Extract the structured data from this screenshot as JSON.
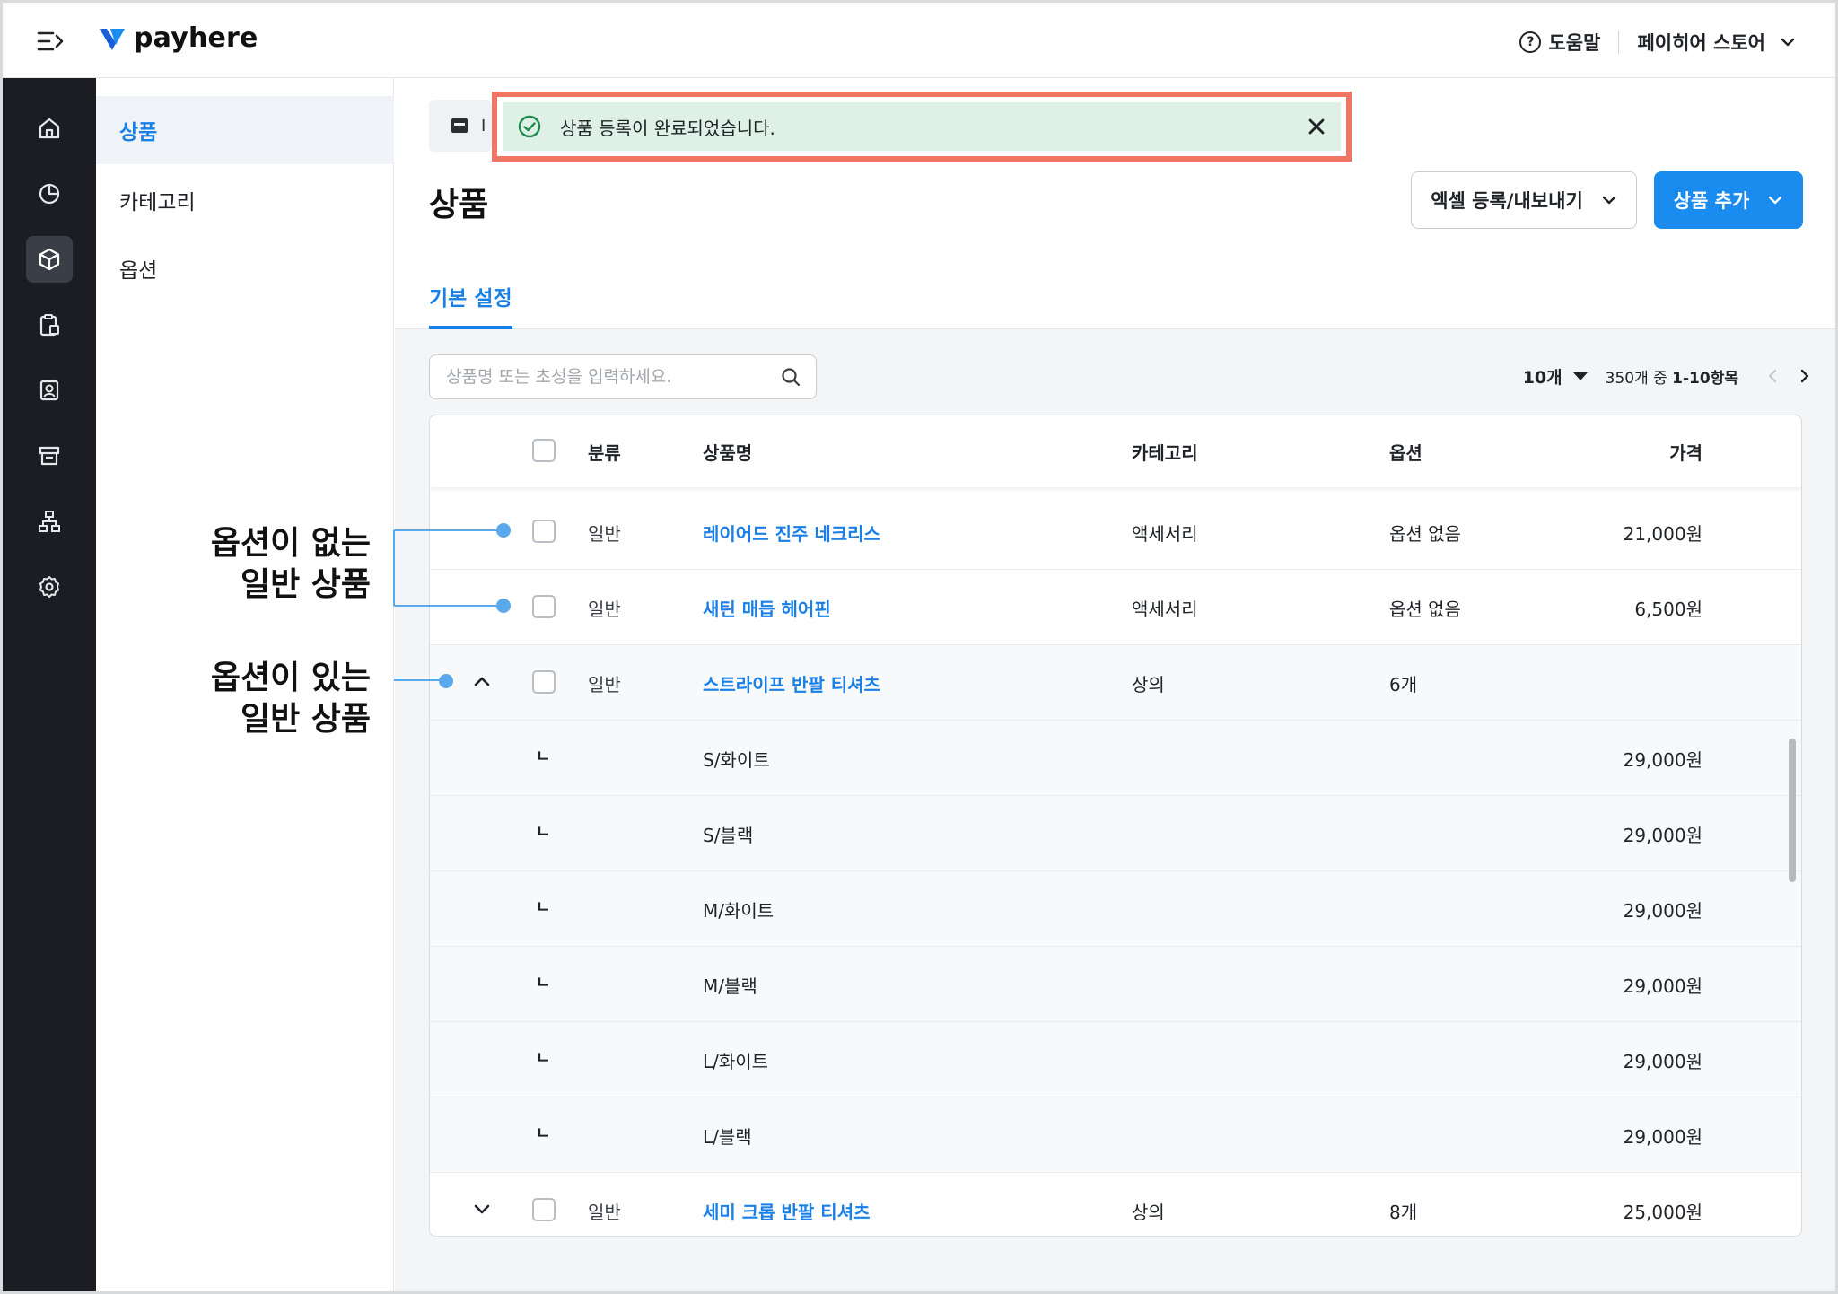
{
  "app": {
    "brand": "payhere",
    "brand_color": "#1a8cf0"
  },
  "topbar": {
    "help_label": "도움말",
    "store_name": "페이히어 스토어"
  },
  "rail": {
    "items": [
      {
        "icon": "home-icon"
      },
      {
        "icon": "chart-pie-icon"
      },
      {
        "icon": "box-icon",
        "active": true
      },
      {
        "icon": "clipboard-icon"
      },
      {
        "icon": "customer-card-icon"
      },
      {
        "icon": "store-icon"
      },
      {
        "icon": "org-chart-icon"
      },
      {
        "icon": "gear-icon"
      }
    ]
  },
  "submenu": {
    "items": [
      "상품",
      "카테고리",
      "옵션"
    ],
    "active_index": 0
  },
  "page": {
    "crumb_letter": "I",
    "title": "상품",
    "excel_button": "엑셀 등록/내보내기",
    "add_button": "상품 추가",
    "tab": "기본 설정"
  },
  "search": {
    "placeholder": "상품명 또는 초성을 입력하세요."
  },
  "pager": {
    "per_page": "10개",
    "range_prefix": "350개 중 ",
    "range_value": "1-10항목"
  },
  "table": {
    "headers": {
      "type": "분류",
      "name": "상품명",
      "category": "카테고리",
      "option": "옵션",
      "price": "가격"
    },
    "rows": [
      {
        "kind": "product",
        "type": "일반",
        "name": "레이어드 진주 네크리스",
        "category": "액세서리",
        "option": "옵션 없음",
        "price": "21,000원"
      },
      {
        "kind": "product",
        "type": "일반",
        "name": "새틴 매듭 헤어핀",
        "category": "액세서리",
        "option": "옵션 없음",
        "price": "6,500원"
      },
      {
        "kind": "product",
        "expanded": true,
        "type": "일반",
        "name": "스트라이프 반팔 티셔츠",
        "category": "상의",
        "option": "6개",
        "price": ""
      },
      {
        "kind": "variant",
        "marker": "ㄴ",
        "name": "S/화이트",
        "price": "29,000원"
      },
      {
        "kind": "variant",
        "marker": "ㄴ",
        "name": "S/블랙",
        "price": "29,000원"
      },
      {
        "kind": "variant",
        "marker": "ㄴ",
        "name": "M/화이트",
        "price": "29,000원"
      },
      {
        "kind": "variant",
        "marker": "ㄴ",
        "name": "M/블랙",
        "price": "29,000원"
      },
      {
        "kind": "variant",
        "marker": "ㄴ",
        "name": "L/화이트",
        "price": "29,000원"
      },
      {
        "kind": "variant",
        "marker": "ㄴ",
        "name": "L/블랙",
        "price": "29,000원"
      },
      {
        "kind": "product",
        "expanded": false,
        "type": "일반",
        "name": "세미 크롭 반팔 티셔츠",
        "category": "상의",
        "option": "8개",
        "price": "25,000원"
      }
    ]
  },
  "toast": {
    "message": "상품 등록이 완료되었습니다.",
    "highlight_color": "#f07564",
    "background": "#dff1e7"
  },
  "annotations": {
    "no_option": [
      "옵션이 없는",
      "일반 상품"
    ],
    "with_option": [
      "옵션이 있는",
      "일반 상품"
    ],
    "line_color": "#5aa9ec"
  }
}
